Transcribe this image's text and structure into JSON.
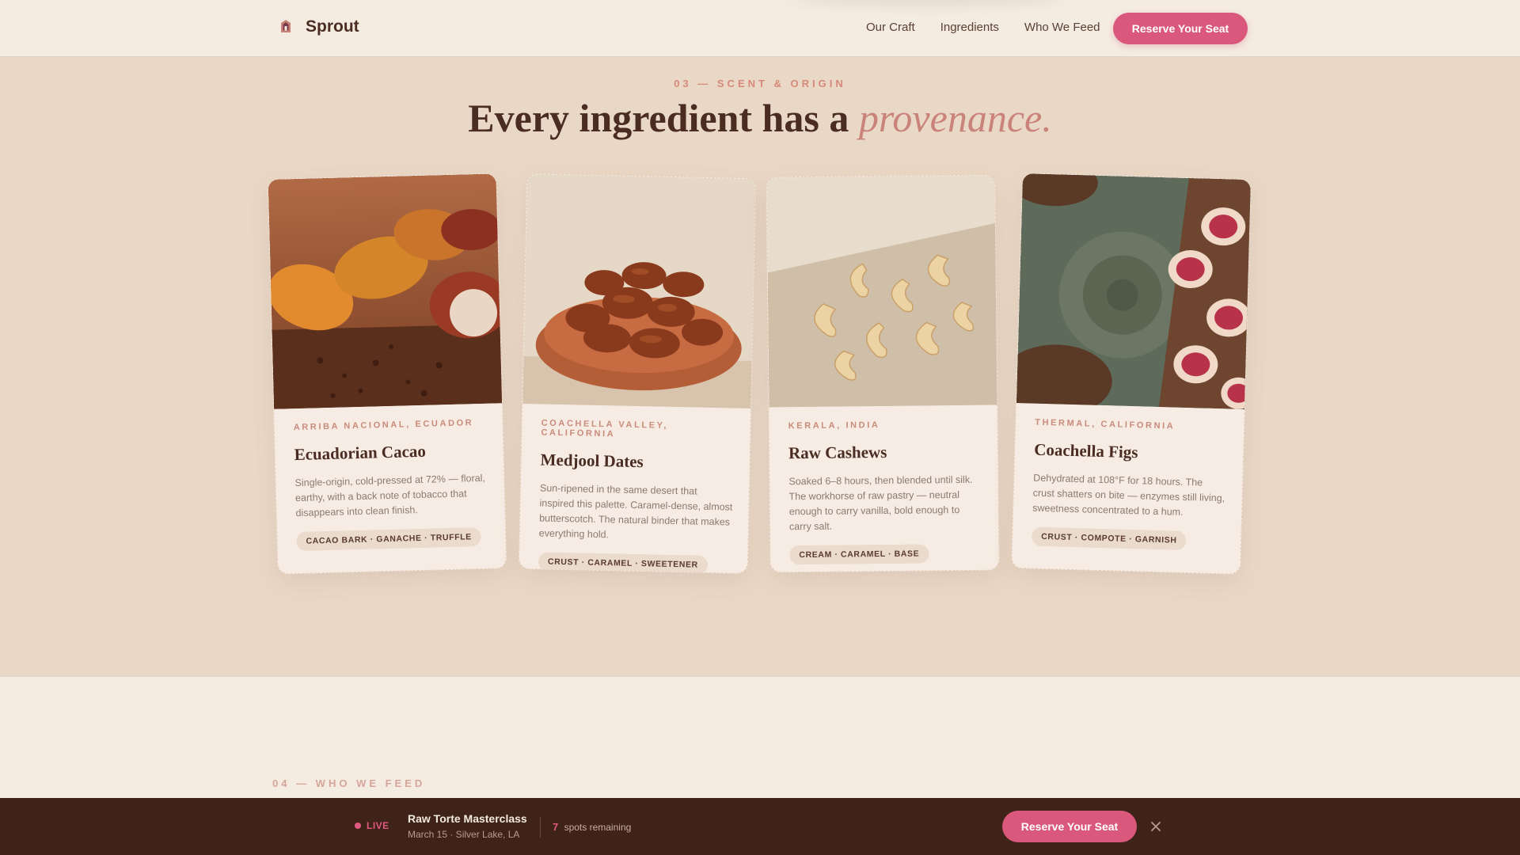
{
  "brand": {
    "name": "Sprout",
    "logo_icon": "sprout-logo-icon"
  },
  "nav": {
    "links": [
      "Our Craft",
      "Ingredients",
      "Who We Feed"
    ],
    "cta_label": "Reserve Your Seat"
  },
  "section": {
    "eyebrow": "03 — SCENT & ORIGIN",
    "headline_main": "Every ingredient has a",
    "headline_accent": "provenance."
  },
  "cards": [
    {
      "origin": "Arriba Nacional, Ecuador",
      "title": "Ecuadorian Cacao",
      "description": "Single-origin, cold-pressed at 72% — floral, earthy, with a back note of tobacco that disappears into clean finish.",
      "tags": "Cacao Bark · Ganache · Truffle",
      "image": "cacao-pods-photo"
    },
    {
      "origin": "Coachella Valley, California",
      "title": "Medjool Dates",
      "description": "Sun-ripened in the same desert that inspired this palette. Caramel-dense, almost butterscotch. The natural binder that makes everything hold.",
      "tags": "Crust · Caramel · Sweetener",
      "image": "medjool-dates-bowl-photo"
    },
    {
      "origin": "Kerala, India",
      "title": "Raw Cashews",
      "description": "Soaked 6–8 hours, then blended until silk. The workhorse of raw pastry — neutral enough to carry vanilla, bold enough to carry salt.",
      "tags": "Cream · Caramel · Base",
      "image": "raw-cashews-photo"
    },
    {
      "origin": "Thermal, California",
      "title": "Coachella Figs",
      "description": "Dehydrated at 108°F for 18 hours. The crust shatters on bite — enzymes still living, sweetness concentrated to a hum.",
      "tags": "Crust · Compote · Garnish",
      "image": "sliced-figs-photo"
    }
  ],
  "next_section": {
    "label": "04 — WHO WE FEED"
  },
  "banner": {
    "live_label": "LIVE",
    "event_title": "Raw Torte Masterclass",
    "event_details": "March 15 · Silver Lake, LA",
    "spots_count": "7",
    "spots_label": "spots remaining",
    "cta_label": "Reserve Your Seat",
    "close_icon": "close-icon"
  },
  "colors": {
    "accent": "#d9587c",
    "headline": "#4a2c22",
    "accent_italic": "#c9837a",
    "page_bg": "#ead8c6",
    "banner_bg": "#3f2218"
  }
}
